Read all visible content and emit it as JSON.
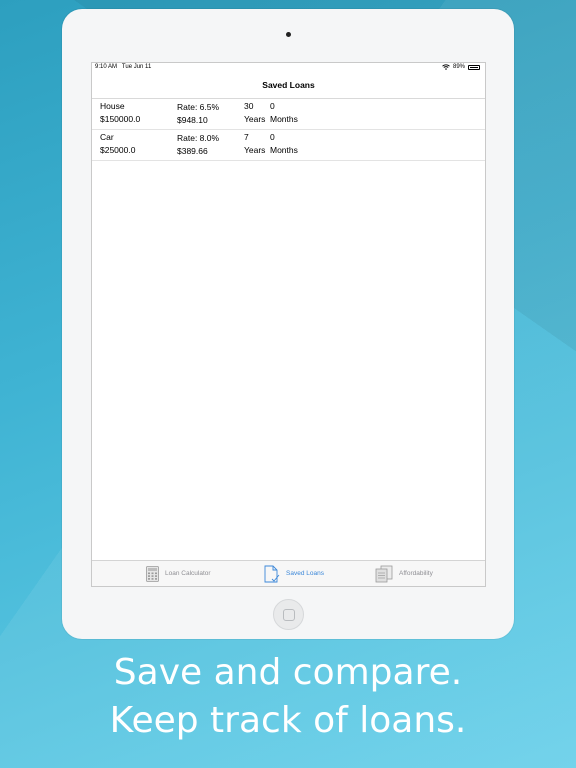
{
  "status_bar": {
    "time": "9:10 AM",
    "date": "Tue Jun 11",
    "battery": "89%"
  },
  "nav": {
    "title": "Saved Loans"
  },
  "loans": [
    {
      "name": "House",
      "amount": "$150000.0",
      "rate": "Rate: 6.5%",
      "payment": "$948.10",
      "years": "30",
      "months": "0",
      "years_label": "Years",
      "months_label": "Months"
    },
    {
      "name": "Car",
      "amount": "$25000.0",
      "rate": "Rate: 8.0%",
      "payment": "$389.66",
      "years": "7",
      "months": "0",
      "years_label": "Years",
      "months_label": "Months"
    }
  ],
  "tabs": [
    {
      "label": "Loan Calculator",
      "icon": "calculator-icon",
      "active": false
    },
    {
      "label": "Saved Loans",
      "icon": "document-check-icon",
      "active": true
    },
    {
      "label": "Affordability",
      "icon": "documents-icon",
      "active": false
    }
  ],
  "tagline": {
    "line1": "Save and compare.",
    "line2": "Keep track of loans."
  },
  "colors": {
    "accent": "#3b87d8",
    "background": "#3fb3d3"
  }
}
